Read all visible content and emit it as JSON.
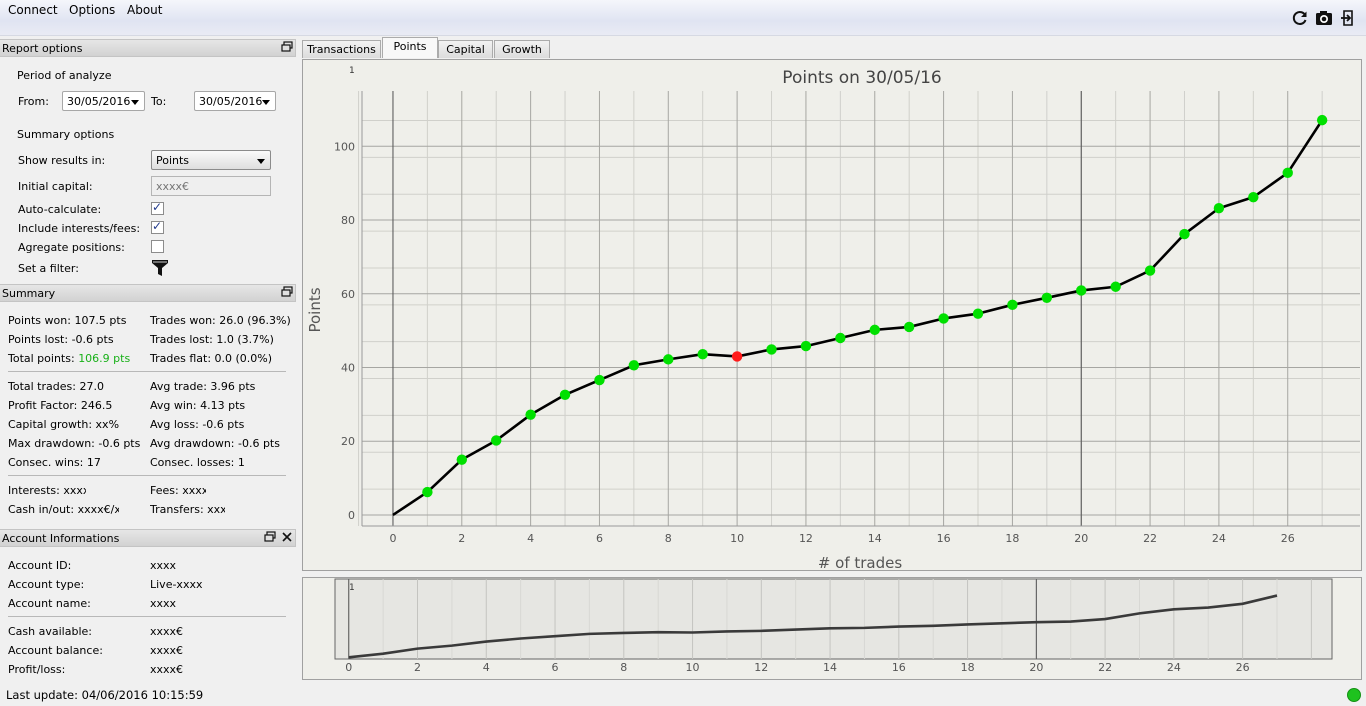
{
  "menu": {
    "connect": "Connect",
    "options": "Options",
    "about": "About"
  },
  "toolbar": {
    "refresh_icon": "refresh-icon",
    "camera_icon": "camera-icon",
    "export_icon": "export-icon"
  },
  "report_options": {
    "header": "Report options",
    "period_title": "Period of analyze",
    "from_label": "From:",
    "from_value": "30/05/2016",
    "to_label": "To:",
    "to_value": "30/05/2016",
    "summary_title": "Summary options",
    "show_results_label": "Show results in:",
    "show_results_value": "Points",
    "initial_capital_label": "Initial capital:",
    "initial_capital_placeholder": "xxxx€",
    "auto_calc_label": "Auto-calculate:",
    "auto_calc_checked": true,
    "include_fees_label": "Include interests/fees:",
    "include_fees_checked": true,
    "aggregate_label": "Agregate positions:",
    "aggregate_checked": false,
    "filter_label": "Set a filter:"
  },
  "summary": {
    "header": "Summary",
    "points_won": "Points won: 107.5 pts",
    "points_lost": "Points lost: -0.6 pts",
    "total_points_label": "Total points:",
    "total_points_value": "106.9 pts",
    "trades_won": "Trades won: 26.0 (96.3%)",
    "trades_lost": "Trades lost: 1.0 (3.7%)",
    "trades_flat": "Trades flat: 0.0 (0.0%)",
    "total_trades": "Total trades: 27.0",
    "profit_factor": "Profit Factor: 246.5",
    "capital_growth": "Capital growth: xx%",
    "max_drawdown": "Max drawdown: -0.6 pts",
    "consec_wins": "Consec. wins: 17",
    "avg_trade": "Avg trade: 3.96 pts",
    "avg_win": "Avg win: 4.13 pts",
    "avg_loss": "Avg loss: -0.6 pts",
    "avg_drawdown": "Avg drawdown: -0.6 pts",
    "consec_losses": "Consec. losses: 1",
    "interests": "Interests: xxxx€",
    "fees": "Fees: xxxx€",
    "cash_inout": "Cash in/out: xxxx€/xxxx€",
    "transfers": "Transfers: xxxx"
  },
  "account": {
    "header": "Account Informations",
    "id_label": "Account ID:",
    "id_value": "xxxx",
    "type_label": "Account type:",
    "type_value": "Live-xxxx",
    "name_label": "Account name:",
    "name_value": "xxxx",
    "cash_label": "Cash available:",
    "cash_value": "xxxx€",
    "balance_label": "Account balance:",
    "balance_value": "xxxx€",
    "pl_label": "Profit/loss:",
    "pl_value": "xxxx€"
  },
  "status": {
    "last_update": "Last update: 04/06/2016 10:15:59"
  },
  "tabs": [
    "Transactions",
    "Points",
    "Capital",
    "Growth"
  ],
  "active_tab": "Points",
  "colors": {
    "win": "#00e000",
    "loss": "#ff1a1a",
    "total_points": "#18b018"
  },
  "chart_data": {
    "type": "line",
    "title": "Points on 30/05/16",
    "xlabel": "# of trades",
    "ylabel": "Points",
    "corner_label": "1",
    "xlim": [
      -0.9,
      28.1
    ],
    "ylim": [
      -3,
      115
    ],
    "x_ticks": [
      0,
      2,
      4,
      6,
      8,
      10,
      12,
      14,
      16,
      18,
      20,
      22,
      24,
      26
    ],
    "y_ticks": [
      0,
      20,
      40,
      60,
      80,
      100
    ],
    "grid": true,
    "x": [
      0,
      1,
      2,
      3,
      4,
      5,
      6,
      7,
      8,
      9,
      10,
      11,
      12,
      13,
      14,
      15,
      16,
      17,
      18,
      19,
      20,
      21,
      22,
      23,
      24,
      25,
      26,
      27
    ],
    "y": [
      0,
      6.2,
      15,
      20.2,
      27.2,
      32.6,
      36.6,
      40.6,
      42.2,
      43.6,
      43,
      44.9,
      45.8,
      48.0,
      50.2,
      51.0,
      53.3,
      54.6,
      57.0,
      58.9,
      60.9,
      61.9,
      66.3,
      76.2,
      83.2,
      86.2,
      92.8,
      107.1
    ],
    "point_status": [
      "none",
      "win",
      "win",
      "win",
      "win",
      "win",
      "win",
      "win",
      "win",
      "win",
      "loss",
      "win",
      "win",
      "win",
      "win",
      "win",
      "win",
      "win",
      "win",
      "win",
      "win",
      "win",
      "win",
      "win",
      "win",
      "win",
      "win",
      "win"
    ]
  },
  "overview": {
    "corner_label": "1",
    "x_ticks": [
      0,
      2,
      4,
      6,
      8,
      10,
      12,
      14,
      16,
      18,
      20,
      22,
      24,
      26
    ]
  }
}
